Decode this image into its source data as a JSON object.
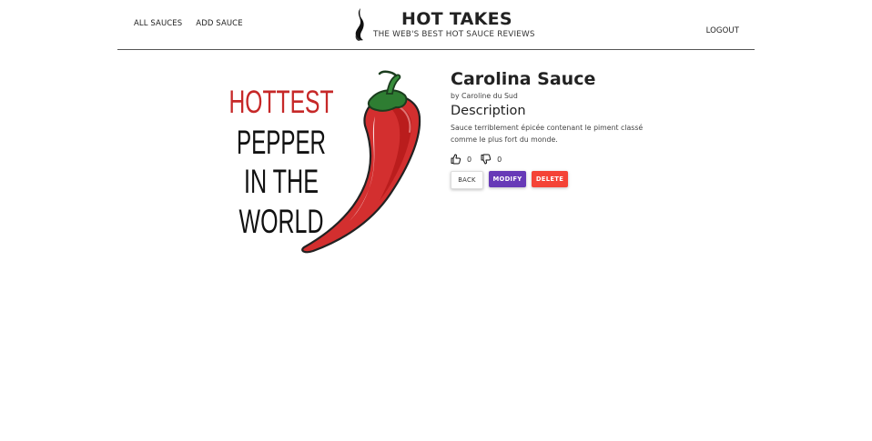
{
  "header": {
    "nav_left": [
      "ALL SAUCES",
      "ADD SAUCE"
    ],
    "title": "HOT TAKES",
    "subtitle": "THE WEB'S BEST HOT SAUCE REVIEWS",
    "logout": "LOGOUT"
  },
  "sauce": {
    "image_text": [
      "HOTTEST",
      "PEPPER",
      "IN THE",
      "WORLD"
    ],
    "name": "Carolina Sauce",
    "manufacturer": "by Caroline du Sud",
    "description_heading": "Description",
    "description": "Sauce terriblement épicée contenant le piment classé comme le plus fort du monde.",
    "likes": "0",
    "dislikes": "0"
  },
  "actions": {
    "back": "BACK",
    "modify": "MODIFY",
    "delete": "DELETE"
  },
  "colors": {
    "accent_modify": "#673ab7",
    "accent_delete": "#f44336",
    "pepper_red": "#d32f2f",
    "hottest_text": "#c62828"
  },
  "icons": {
    "logo": "flame-icon",
    "like": "thumbs-up-icon",
    "dislike": "thumbs-down-icon"
  }
}
